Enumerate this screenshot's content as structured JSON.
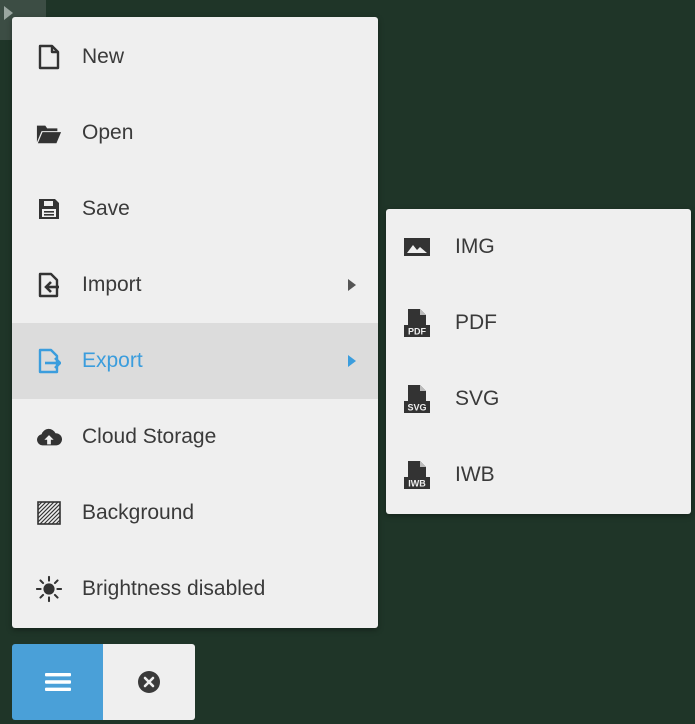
{
  "menu": {
    "items": [
      {
        "label": "New",
        "icon": "new-file-icon"
      },
      {
        "label": "Open",
        "icon": "folder-open-icon"
      },
      {
        "label": "Save",
        "icon": "save-icon"
      },
      {
        "label": "Import",
        "icon": "import-icon",
        "has_submenu": true
      },
      {
        "label": "Export",
        "icon": "export-icon",
        "has_submenu": true,
        "active": true
      },
      {
        "label": "Cloud Storage",
        "icon": "cloud-upload-icon"
      },
      {
        "label": "Background",
        "icon": "background-pattern-icon"
      },
      {
        "label": "Brightness disabled",
        "icon": "brightness-icon"
      }
    ]
  },
  "export_submenu": {
    "items": [
      {
        "label": "IMG",
        "icon": "image-icon"
      },
      {
        "label": "PDF",
        "icon": "pdf-file-icon",
        "badge": "PDF"
      },
      {
        "label": "SVG",
        "icon": "svg-file-icon",
        "badge": "SVG"
      },
      {
        "label": "IWB",
        "icon": "iwb-file-icon",
        "badge": "IWB"
      }
    ]
  },
  "toolbar": {
    "menu_icon": "hamburger-icon",
    "close_icon": "close-circle-icon"
  },
  "colors": {
    "background": "#1f3528",
    "panel": "#efefef",
    "active_row": "#dcdcdc",
    "accent": "#3b9ddd",
    "icon": "#333333"
  }
}
